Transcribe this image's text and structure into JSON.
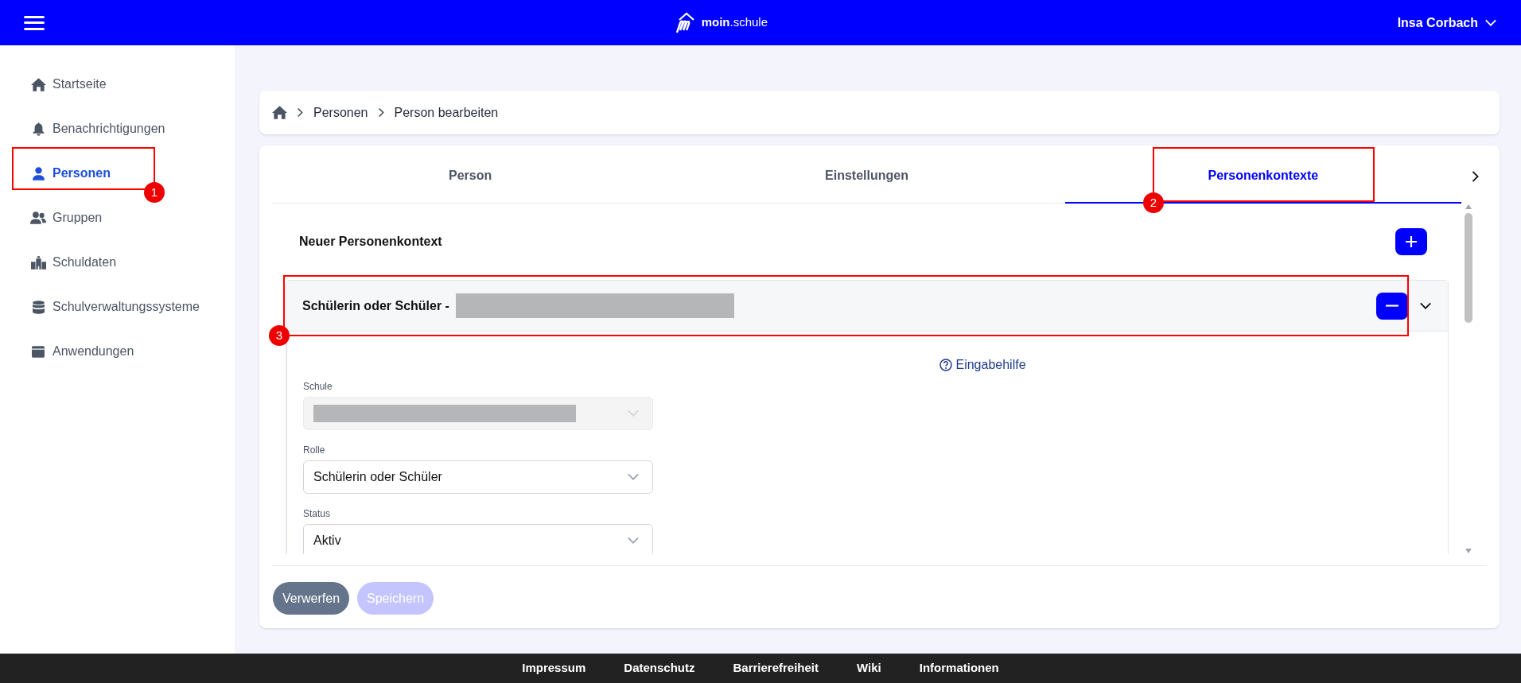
{
  "header": {
    "brand": "**moin**.schule",
    "user": "Insa Corbach"
  },
  "sidebar": {
    "items": [
      {
        "label": "Startseite",
        "kind": "home",
        "selected": false
      },
      {
        "label": "Benachrichtigungen",
        "kind": "bell",
        "selected": false
      },
      {
        "label": "Personen",
        "kind": "person",
        "selected": true
      },
      {
        "label": "Gruppen",
        "kind": "people",
        "selected": false
      },
      {
        "label": "Schuldaten",
        "kind": "building",
        "selected": false
      },
      {
        "label": "Schulverwaltungssysteme",
        "kind": "database",
        "selected": false
      },
      {
        "label": "Anwendungen",
        "kind": "window",
        "selected": false
      }
    ]
  },
  "breadcrumb": [
    "Personen",
    "Person bearbeiten"
  ],
  "tabs": [
    {
      "label": "Person",
      "selected": false
    },
    {
      "label": "Einstellungen",
      "selected": false
    },
    {
      "label": "Personenkontexte",
      "selected": true
    }
  ],
  "new_context": {
    "title": "Neuer Personenkontext"
  },
  "contexts": [
    {
      "title": "Schülerin oder Schüler -",
      "redacted": true,
      "expanded": true,
      "help_link": "Eingabehilfe",
      "fields": [
        {
          "label": "Schule",
          "disabled": true,
          "redacted": true
        },
        {
          "label": "Rolle",
          "value": "Schülerin oder Schüler",
          "disabled": false
        },
        {
          "label": "Status",
          "value": "Aktiv",
          "disabled": false
        }
      ]
    }
  ],
  "buttons": [
    {
      "label": "Verwerfen",
      "disabled": false
    },
    {
      "label": "Speichern",
      "disabled": true
    }
  ],
  "footer": [
    "Impressum",
    "Datenschutz",
    "Barrierefreiheit",
    "Wiki",
    "Informationen"
  ],
  "annotations": [
    {
      "label": "1"
    },
    {
      "label": "2"
    },
    {
      "label": "3"
    }
  ]
}
